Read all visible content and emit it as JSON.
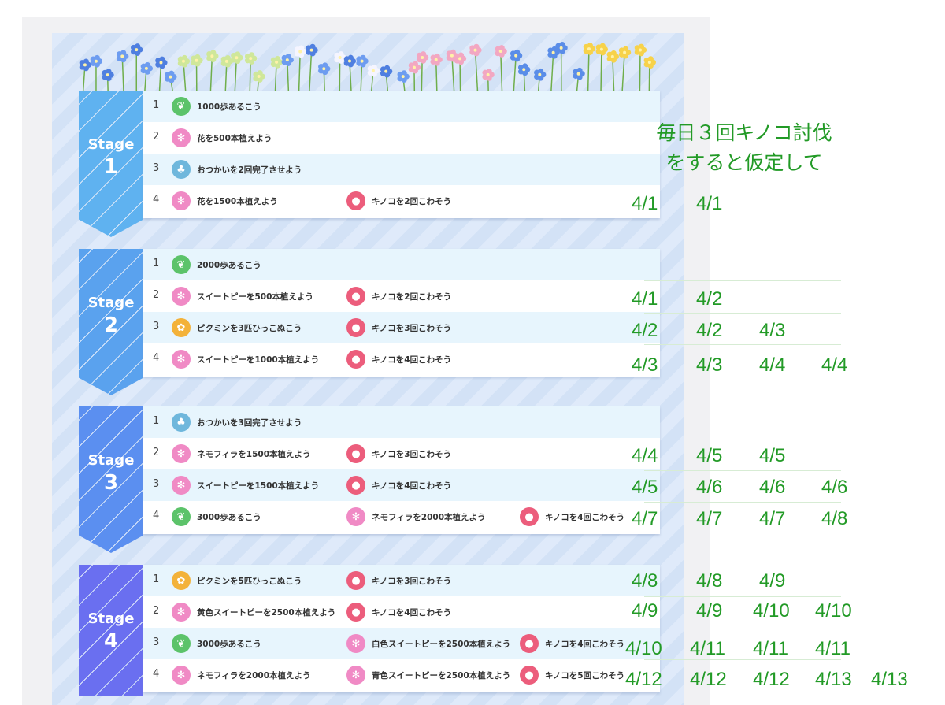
{
  "stages": [
    {
      "label": "Stage",
      "num": "1",
      "color": "#5fb2f0",
      "rows": [
        {
          "n": "1",
          "tasks": [
            {
              "icon": "footprint-icon",
              "text": "1000歩あるこう"
            }
          ]
        },
        {
          "n": "2",
          "tasks": [
            {
              "icon": "flower-icon",
              "text": "花を500本植えよう"
            }
          ]
        },
        {
          "n": "3",
          "tasks": [
            {
              "icon": "tree-icon",
              "text": "おつかいを2回完了させよう"
            }
          ]
        },
        {
          "n": "4",
          "tasks": [
            {
              "icon": "flower-icon",
              "text": "花を1500本植えよう"
            },
            {
              "icon": "mushroom-icon",
              "text": "キノコを2回こわそう"
            }
          ]
        }
      ]
    },
    {
      "label": "Stage",
      "num": "2",
      "color": "#5aa2ee",
      "rows": [
        {
          "n": "1",
          "tasks": [
            {
              "icon": "footprint-icon",
              "text": "2000歩あるこう"
            }
          ]
        },
        {
          "n": "2",
          "tasks": [
            {
              "icon": "flower-icon",
              "text": "スイートピーを500本植えよう"
            },
            {
              "icon": "mushroom-icon",
              "text": "キノコを2回こわそう"
            }
          ]
        },
        {
          "n": "3",
          "tasks": [
            {
              "icon": "pikmin-icon",
              "text": "ピクミンを3匹ひっこぬこう"
            },
            {
              "icon": "mushroom-icon",
              "text": "キノコを3回こわそう"
            }
          ]
        },
        {
          "n": "4",
          "tasks": [
            {
              "icon": "flower-icon",
              "text": "スイートピーを1000本植えよう"
            },
            {
              "icon": "mushroom-icon",
              "text": "キノコを4回こわそう"
            }
          ]
        }
      ]
    },
    {
      "label": "Stage",
      "num": "3",
      "color": "#5b8ff0",
      "rows": [
        {
          "n": "1",
          "tasks": [
            {
              "icon": "tree-icon",
              "text": "おつかいを3回完了させよう"
            }
          ]
        },
        {
          "n": "2",
          "tasks": [
            {
              "icon": "flower-icon",
              "text": "ネモフィラを1500本植えよう"
            },
            {
              "icon": "mushroom-icon",
              "text": "キノコを3回こわそう"
            }
          ]
        },
        {
          "n": "3",
          "tasks": [
            {
              "icon": "flower-icon",
              "text": "スイートピーを1500本植えよう"
            },
            {
              "icon": "mushroom-icon",
              "text": "キノコを4回こわそう"
            }
          ]
        },
        {
          "n": "4",
          "tasks": [
            {
              "icon": "footprint-icon",
              "text": "3000歩あるこう"
            },
            {
              "icon": "flower-icon",
              "text": "ネモフィラを2000本植えよう"
            },
            {
              "icon": "mushroom-icon",
              "text": "キノコを4回こわそう"
            }
          ]
        }
      ]
    },
    {
      "label": "Stage",
      "num": "4",
      "color": "#6a6ff0",
      "rows": [
        {
          "n": "1",
          "tasks": [
            {
              "icon": "pikmin-icon",
              "text": "ピクミンを5匹ひっこぬこう"
            },
            {
              "icon": "mushroom-icon",
              "text": "キノコを3回こわそう"
            }
          ]
        },
        {
          "n": "2",
          "tasks": [
            {
              "icon": "flower-icon",
              "text": "黄色スイートピーを2500本植えよう"
            },
            {
              "icon": "mushroom-icon",
              "text": "キノコを4回こわそう"
            }
          ]
        },
        {
          "n": "3",
          "tasks": [
            {
              "icon": "footprint-icon",
              "text": "3000歩あるこう"
            },
            {
              "icon": "flower-icon",
              "text": "白色スイートピーを2500本植えよう"
            },
            {
              "icon": "mushroom-icon",
              "text": "キノコを4回こわそう"
            }
          ]
        },
        {
          "n": "4",
          "tasks": [
            {
              "icon": "flower-icon",
              "text": "ネモフィラを2000本植えよう"
            },
            {
              "icon": "flower-icon",
              "text": "青色スイートピーを2500本植えよう"
            },
            {
              "icon": "mushroom-icon",
              "text": "キノコを5回こわそう"
            }
          ]
        }
      ]
    }
  ],
  "annotation": {
    "note_line1": "毎日３回キノコ討伐",
    "note_line2": "をすると仮定して",
    "dates": {
      "s1r4": [
        "4/1",
        "4/1"
      ],
      "s2r2": [
        "4/1",
        "4/2"
      ],
      "s2r3": [
        "4/2",
        "4/2",
        "4/3"
      ],
      "s2r4": [
        "4/3",
        "4/3",
        "4/4",
        "4/4"
      ],
      "s3r2": [
        "4/4",
        "4/5",
        "4/5"
      ],
      "s3r3": [
        "4/5",
        "4/6",
        "4/6",
        "4/6"
      ],
      "s3r4": [
        "4/7",
        "4/7",
        "4/7",
        "4/8"
      ],
      "s4r1": [
        "4/8",
        "4/8",
        "4/9"
      ],
      "s4r2": [
        "4/9",
        "4/9",
        "4/10",
        "4/10"
      ],
      "s4r3": [
        "4/10",
        "4/11",
        "4/11",
        "4/11"
      ],
      "s4r4": [
        "4/12",
        "4/12",
        "4/12",
        "4/13",
        "4/13"
      ]
    }
  },
  "colors": {
    "annotation": "#229a26",
    "banner_text": "#ffffff"
  }
}
